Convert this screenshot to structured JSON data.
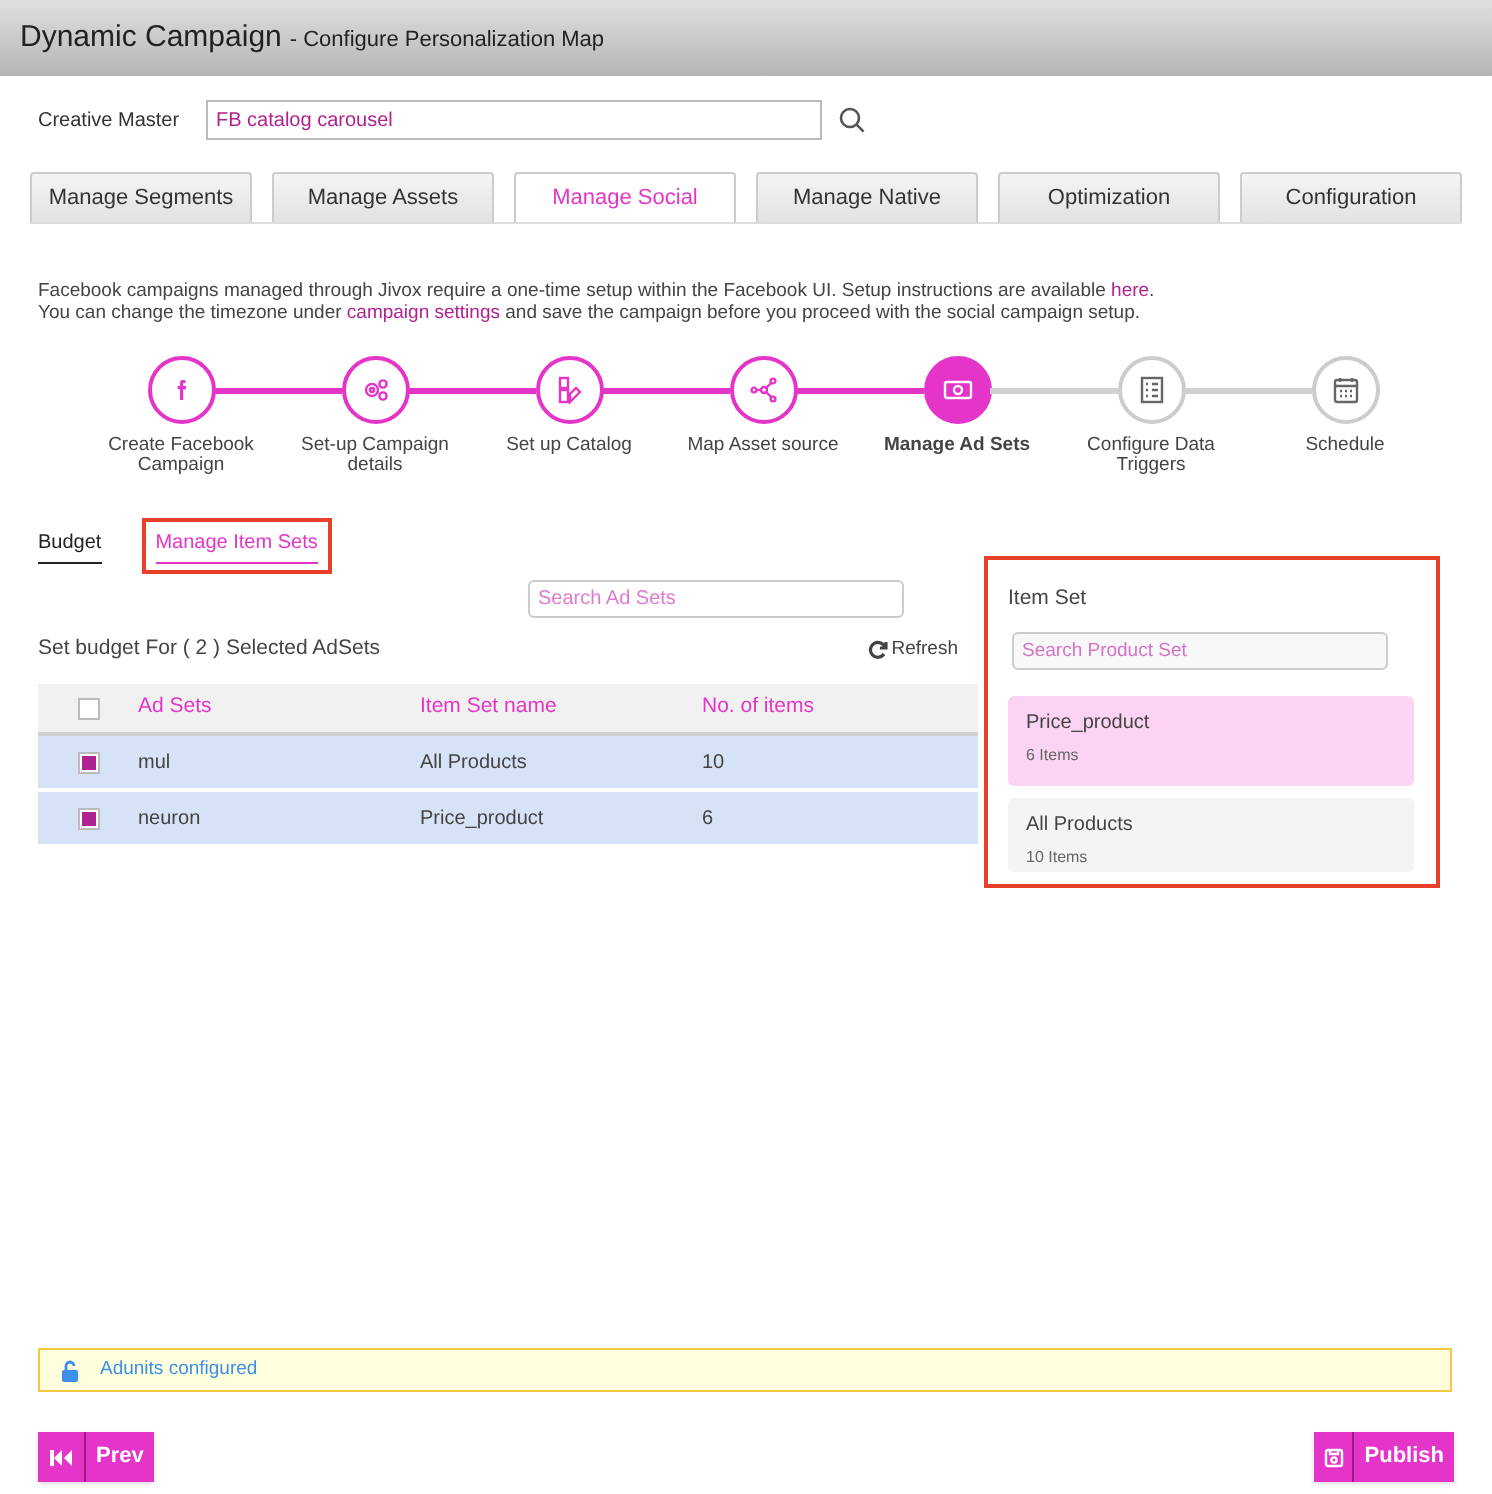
{
  "header": {
    "title": "Dynamic Campaign",
    "subtitle": "- Configure Personalization Map"
  },
  "creative_master": {
    "label": "Creative Master",
    "value": "FB catalog carousel"
  },
  "tabs": [
    {
      "label": "Manage Segments",
      "selected": false
    },
    {
      "label": "Manage Assets",
      "selected": false
    },
    {
      "label": "Manage Social",
      "selected": true
    },
    {
      "label": "Manage Native",
      "selected": false
    },
    {
      "label": "Optimization",
      "selected": false
    },
    {
      "label": "Configuration",
      "selected": false
    }
  ],
  "info": {
    "line1": "Facebook campaigns managed through Jivox require a one-time setup within the Facebook UI. Setup instructions are available ",
    "link1": "here",
    "line1_end": ".",
    "line2_start": "You can change the timezone under ",
    "link2": "campaign settings",
    "line2_end": " and save the campaign before you proceed with the social campaign setup."
  },
  "steps": [
    {
      "label": "Create Facebook Campaign",
      "kind": "facebook",
      "completed": true,
      "selected": false
    },
    {
      "label": "Set-up Campaign details",
      "kind": "gears",
      "completed": true,
      "selected": false
    },
    {
      "label": "Set up Catalog",
      "kind": "catalog",
      "completed": true,
      "selected": false
    },
    {
      "label": "Map Asset source",
      "kind": "share",
      "completed": true,
      "selected": false
    },
    {
      "label": "Manage Ad Sets",
      "kind": "money",
      "completed": false,
      "selected": true
    },
    {
      "label": "Configure Data Triggers",
      "kind": "list",
      "completed": false,
      "selected": false
    },
    {
      "label": "Schedule",
      "kind": "calendar",
      "completed": false,
      "selected": false
    }
  ],
  "subtabs": [
    {
      "label": "Budget",
      "selected": false,
      "highlighted": false
    },
    {
      "label": "Manage Item Sets",
      "selected": true,
      "highlighted": true
    }
  ],
  "adset_search": {
    "placeholder": "Search Ad Sets"
  },
  "table_title": "Set budget For ( 2 ) Selected AdSets",
  "refresh": "Refresh",
  "table": {
    "select_all": false,
    "columns": [
      "Ad Sets",
      "Item Set name",
      "No. of items"
    ],
    "rows": [
      {
        "checked": true,
        "cells": [
          "mul",
          "All Products",
          "10"
        ]
      },
      {
        "checked": true,
        "cells": [
          "neuron",
          "Price_product",
          "6"
        ]
      }
    ]
  },
  "item_set_panel": {
    "title": "Item Set",
    "highlighted": true,
    "search_placeholder": "Search Product Set",
    "items": [
      {
        "name": "Price_product",
        "count": "6 Items",
        "selected": true
      },
      {
        "name": "All Products",
        "count": "10 Items",
        "selected": false
      }
    ]
  },
  "alert": "Adunits configured",
  "buttons": {
    "prev": "Prev",
    "publish": "Publish"
  }
}
